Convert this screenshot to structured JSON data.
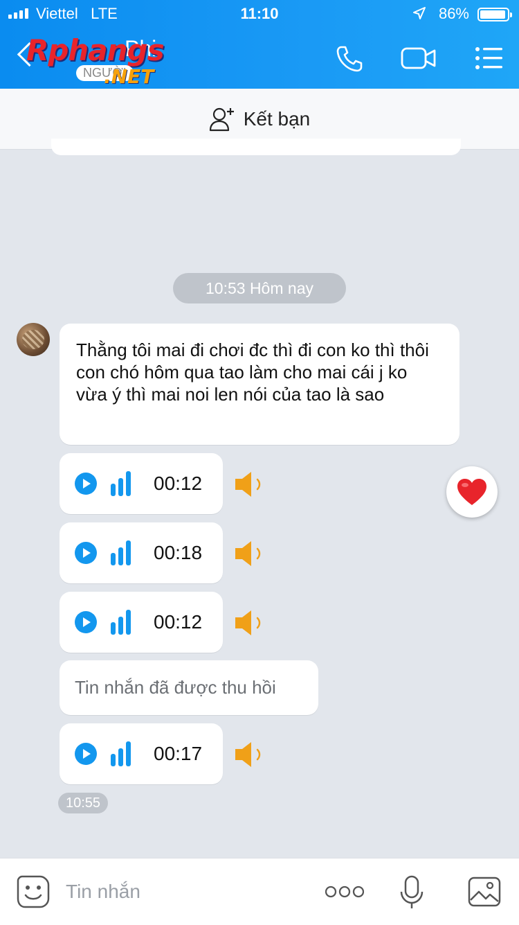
{
  "status_bar": {
    "carrier": "Viettel",
    "network": "LTE",
    "time": "11:10",
    "battery_percent": "86%"
  },
  "header": {
    "contact_name": "Phi",
    "back_icon": "chevron-left-icon",
    "actions": [
      "phone-icon",
      "video-camera-icon",
      "menu-list-icon"
    ],
    "watermark": {
      "brand": "Rphangs",
      "sub": "NGƯỜI",
      "domain": ".NET"
    }
  },
  "friend_bar": {
    "label": "Kết bạn",
    "icon": "add-user-icon"
  },
  "conversation": {
    "date_separator": "10:53 Hôm nay",
    "text_message": "Thằng tôi mai đi chơi đc thì đi con ko thì thôi con chó hôm qua tao làm cho mai cái j ko vừa ý thì mai noi len nói của tao là sao",
    "voice_messages": [
      {
        "duration": "00:12"
      },
      {
        "duration": "00:18"
      },
      {
        "duration": "00:12"
      }
    ],
    "recalled_message": "Tin nhắn đã được thu hồi",
    "last_voice": {
      "duration": "00:17"
    },
    "last_time": "10:55",
    "reaction_icon": "heart-icon"
  },
  "composer": {
    "placeholder": "Tin nhắn",
    "icons": [
      "sticker-icon",
      "more-dots-icon",
      "microphone-icon",
      "image-icon"
    ]
  },
  "colors": {
    "header_blue": "#0a8cf0",
    "play_blue": "#1397ee",
    "speaker_orange": "#f0a018",
    "heart_red": "#e8242b"
  }
}
